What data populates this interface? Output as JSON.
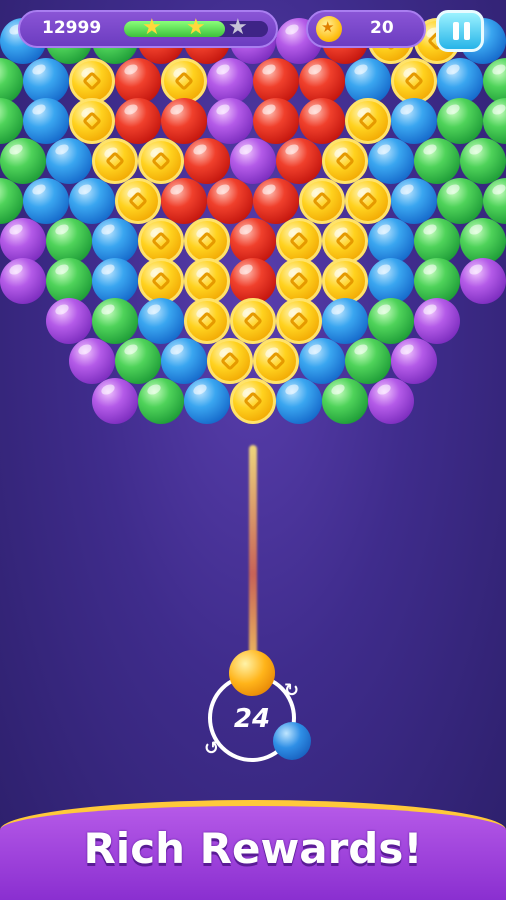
{
  "hud": {
    "score": "12999",
    "level_progress": 0.7,
    "stars_earned": 2,
    "stars_total": 3,
    "coins": "20"
  },
  "shooter": {
    "moves_left": "24",
    "current_ball_color": "#ffb41a",
    "next_ball_color": "#2f8fe6"
  },
  "banner": {
    "text": "Rich Rewards!"
  },
  "colors": {
    "background": "#3f2c8c",
    "banner": "#a145de",
    "banner_border": "#ffc93a"
  },
  "grid": {
    "rows": [
      "BGGRRPPRCCB",
      "GBCRCPRRBCBG",
      "GBCRRPRRCBGG",
      "GBCCRPRCBGG",
      "GBBCRRRCCBGG",
      "PGBCCRCCBGG",
      "PGBCCRCCBGP",
      "PGBCCCBGP",
      "PGBCCBGP",
      "PGBCBGP"
    ],
    "legend": {
      "B": "blue",
      "G": "green",
      "P": "purple",
      "R": "red",
      "C": "coin"
    }
  }
}
